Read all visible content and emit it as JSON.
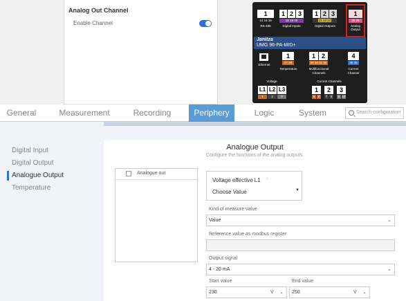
{
  "aoc": {
    "title": "Analog Out Channel",
    "enable_label": "Enable Channel",
    "enabled": true
  },
  "device": {
    "brand": "Janitza",
    "model": "UMG 96-PA-MID+",
    "rs485": {
      "number": "1",
      "pins": "14 15 16",
      "label": "RS-485"
    },
    "digital_inputs": {
      "numbers": [
        "1",
        "2",
        "3"
      ],
      "pins": "18 19 20",
      "label": "Digital Inputs"
    },
    "digital_outputs": {
      "numbers": [
        "1",
        "2",
        "3"
      ],
      "pins": "22 23 24",
      "label": "Digital Outputs"
    },
    "analog_output": {
      "number": "1",
      "pins": "25 26",
      "label": "Analog Output"
    },
    "ethernet": {
      "label": "Ethernet"
    },
    "temperature": {
      "number": "1",
      "pins": "27 28",
      "label": "Temperature"
    },
    "multifunctional": {
      "numbers": [
        "1",
        "2"
      ],
      "pins": "29 30 31 32",
      "label": "Multifunctional Channels"
    },
    "current_channel": {
      "number": "4",
      "pins": "35 36",
      "label": "Current Channel"
    },
    "voltage": {
      "numbers": [
        "L1",
        "L2",
        "L3"
      ],
      "pins": [
        "1",
        "2",
        "3"
      ],
      "label": "Voltage"
    },
    "current_channels": {
      "numbers": [
        "1",
        "2",
        "3"
      ],
      "pins": [
        "5",
        "6",
        "7",
        "8",
        "9",
        "10"
      ],
      "label": "Current Channels"
    }
  },
  "tabs": [
    {
      "label": "General",
      "active": false
    },
    {
      "label": "Measurement",
      "active": false
    },
    {
      "label": "Recording",
      "active": false
    },
    {
      "label": "Periphery",
      "active": true
    },
    {
      "label": "Logic",
      "active": false
    },
    {
      "label": "System",
      "active": false
    }
  ],
  "search": {
    "placeholder": "Search configuration"
  },
  "sidebar": {
    "items": [
      {
        "label": "Digital Input",
        "active": false
      },
      {
        "label": "Digital Output",
        "active": false
      },
      {
        "label": "Analogue Output",
        "active": true
      },
      {
        "label": "Temperature",
        "active": false
      }
    ]
  },
  "panel": {
    "title": "Analogue Output",
    "subtitle": "Configure the functions of the analog outputs.",
    "list_item": "Analogue out",
    "card_title": "Voltage effective L1",
    "card_chevron": "‹",
    "choose_value": "Choose Value",
    "kind_label": "Kind of measure value",
    "kind_value": "Value",
    "ref_label": "Reference value as modbus register",
    "ref_value": "",
    "output_label": "Output signal",
    "output_value": "4 - 20 mA",
    "start_label": "Start value",
    "start_value": "230",
    "start_unit": "V",
    "end_label": "End value",
    "end_value": "250",
    "end_unit": "V"
  },
  "colors": {
    "accent": "#2c6fd6",
    "active_tab": "#5b9bd5",
    "device_body": "#1e1e1e",
    "brand_band": "#2c4f88",
    "highlight": "#d02020",
    "pin_purple": "#7b3fa0",
    "pin_yellow": "#e0c020",
    "pin_green": "#2f8a3a",
    "pin_pink": "#e0508a",
    "pin_orange": "#c86a20",
    "pin_blue": "#2c6fd6"
  },
  "icons": [
    "search-icon",
    "checkbox-icon",
    "chevron-left-icon",
    "dropdown-arrow-icon",
    "chevron-down-icon",
    "ethernet-port-icon",
    "toggle-switch-icon"
  ]
}
